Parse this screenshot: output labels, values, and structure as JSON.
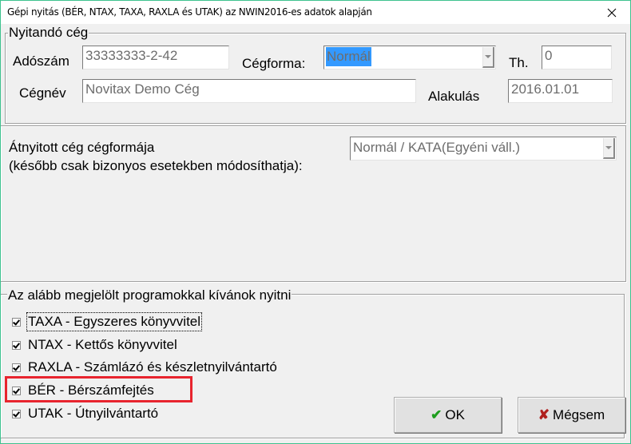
{
  "window": {
    "title": "Gépi nyitás (BÉR, NTAX, TAXA, RAXLA és UTAK) az NWIN2016-es adatok alapján",
    "close_icon": "close-icon"
  },
  "company_group": {
    "legend": "Nyitandó cég",
    "tax_number_label": "Adószám",
    "tax_number_value": "33333333-2-42",
    "company_form_label": "Cégforma:",
    "company_form_value": "Normál",
    "th_label": "Th.",
    "th_value": "0",
    "company_name_label": "Cégnév",
    "company_name_value": "Novitax Demo Cég",
    "founded_label": "Alakulás",
    "founded_value": "2016.01.01"
  },
  "opened_form": {
    "label_line1": "Átnyitott cég cégformája",
    "label_line2": "(később csak bizonyos esetekben módosíthatja):",
    "value": "Normál / KATA(Egyéni váll.)"
  },
  "programs_group": {
    "legend": "Az alább megjelölt programokkal kívánok nyitni",
    "items": [
      {
        "label": "TAXA - Egyszeres könyvvitel",
        "checked": true
      },
      {
        "label": "NTAX - Kettős könyvvitel",
        "checked": true
      },
      {
        "label": "RAXLA - Számlázó és készletnyilvántartó",
        "checked": true
      },
      {
        "label": "BÉR - Bérszámfejtés",
        "checked": true
      },
      {
        "label": "UTAK - Útnyilvántartó",
        "checked": true
      }
    ]
  },
  "buttons": {
    "ok_label": "OK",
    "cancel_label": "Mégsem"
  },
  "colors": {
    "accent_border": "#3ec28f",
    "highlight_box": "#e8242e",
    "selection": "#3399ff",
    "ok_icon": "#1e9e1e",
    "cancel_icon": "#b0201e"
  }
}
